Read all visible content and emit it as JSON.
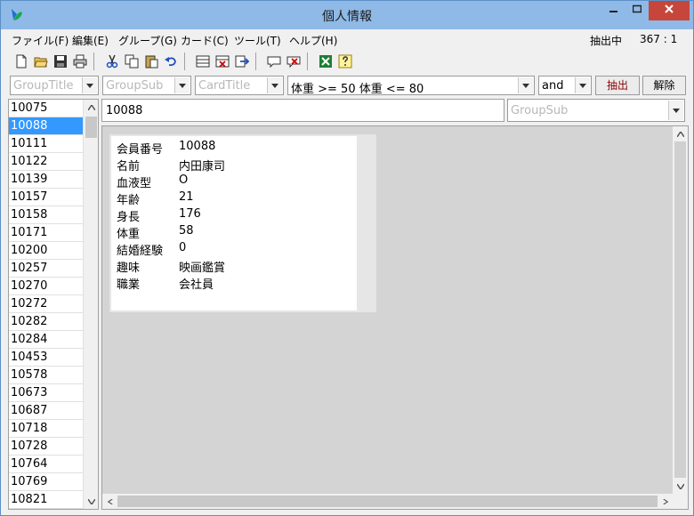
{
  "window": {
    "title": "個人情報"
  },
  "menu": [
    {
      "label": "ファイル(F)"
    },
    {
      "label": "編集(E)"
    },
    {
      "label": "グループ(G)"
    },
    {
      "label": "カード(C)"
    },
    {
      "label": "ツール(T)"
    },
    {
      "label": "ヘルプ(H)"
    }
  ],
  "status": {
    "mode": "抽出中",
    "count": "367 : 1"
  },
  "filter": {
    "group_title": "GroupTitle",
    "group_sub": "GroupSub",
    "card_title": "CardTitle",
    "condition": "体重 >= 50 体重 <= 80",
    "logic": "and",
    "extract_label": "抽出",
    "clear_label": "解除"
  },
  "record_ids": [
    "10075",
    "10088",
    "10111",
    "10122",
    "10139",
    "10157",
    "10158",
    "10171",
    "10200",
    "10257",
    "10270",
    "10272",
    "10282",
    "10284",
    "10453",
    "10578",
    "10673",
    "10687",
    "10718",
    "10728",
    "10764",
    "10769",
    "10821"
  ],
  "selected_id": "10088",
  "detail": {
    "id_value": "10088",
    "group_sub": "GroupSub",
    "fields": [
      {
        "label": "会員番号",
        "value": "10088"
      },
      {
        "label": "名前",
        "value": "内田康司"
      },
      {
        "label": "血液型",
        "value": "O"
      },
      {
        "label": "年齢",
        "value": "21"
      },
      {
        "label": "身長",
        "value": "176"
      },
      {
        "label": "体重",
        "value": "58"
      },
      {
        "label": "結婚経験",
        "value": "0"
      },
      {
        "label": "趣味",
        "value": "映画鑑賞"
      },
      {
        "label": "職業",
        "value": "会社員"
      }
    ]
  },
  "colors": {
    "selection": "#3399ff",
    "titlebar": "#8fb9e6",
    "close": "#c7463b",
    "extract_text": "#8b0000"
  }
}
